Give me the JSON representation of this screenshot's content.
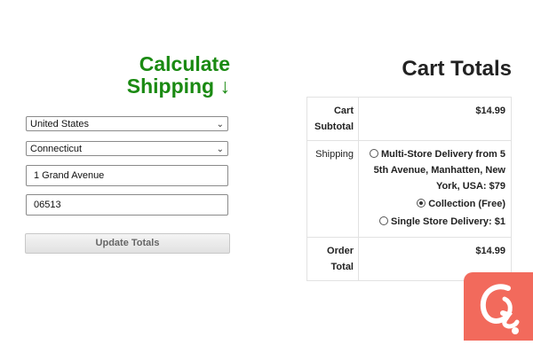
{
  "shipping": {
    "title_line1": "Calculate",
    "title_line2": "Shipping ↓",
    "country": "United States",
    "state": "Connecticut",
    "address": "1 Grand Avenue",
    "postcode": "06513",
    "update_label": "Update Totals"
  },
  "cart_totals": {
    "title": "Cart Totals",
    "subtotal_label_1": "Cart",
    "subtotal_label_2": "Subtotal",
    "subtotal_value": "$14.99",
    "shipping_label": "Shipping",
    "options": [
      {
        "label": "Multi-Store Delivery from 5 5th Avenue, Manhatten, New York, USA: $79",
        "checked": false
      },
      {
        "label": "Collection (Free)",
        "checked": true
      },
      {
        "label": "Single Store Delivery: $1",
        "checked": false
      }
    ],
    "order_total_label_1": "Order",
    "order_total_label_2": "Total",
    "order_total_value": "$14.99"
  },
  "colors": {
    "heading_green": "#1a8a12",
    "logo_bg": "#f26a5c"
  },
  "icons": {
    "select_chevron": "chevron-down-icon",
    "logo": "brand-logo-icon"
  }
}
